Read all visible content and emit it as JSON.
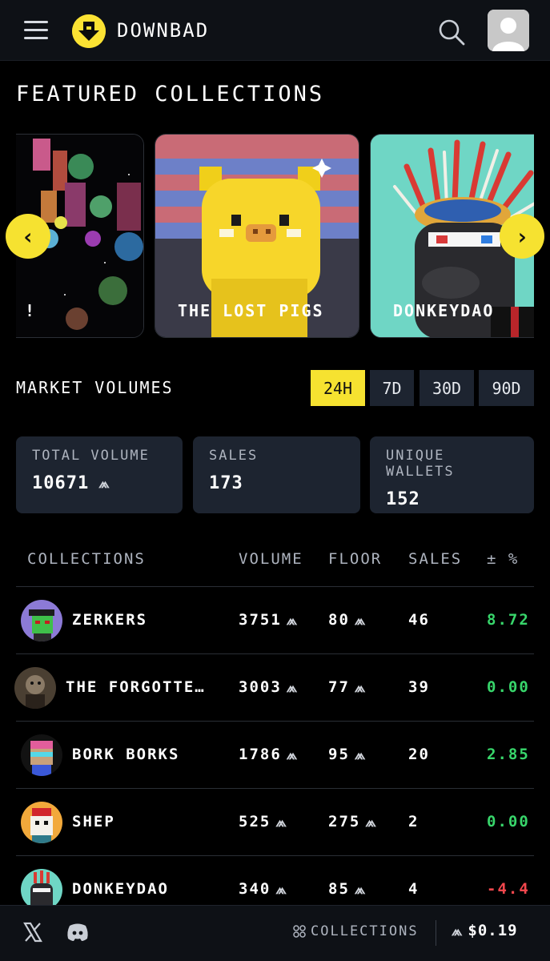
{
  "header": {
    "brand": "DOWNBAD",
    "menu_icon": "hamburger-icon",
    "search_icon": "search-icon",
    "avatar_icon": "user-avatar-icon"
  },
  "featured": {
    "title": "FEATURED COLLECTIONS",
    "cards": [
      {
        "label": "!"
      },
      {
        "label": "THE LOST PIGS"
      },
      {
        "label": "DONKEYDAO"
      }
    ],
    "prev_glyph": "‹",
    "next_glyph": "›"
  },
  "market": {
    "title": "MARKET VOLUMES",
    "tabs": [
      "24H",
      "7D",
      "30D",
      "90D"
    ],
    "active_tab": "24H",
    "stats": [
      {
        "label": "TOTAL VOLUME",
        "value": "10671"
      },
      {
        "label": "SALES",
        "value": "173"
      },
      {
        "label": "UNIQUE WALLETS",
        "value": "152"
      }
    ]
  },
  "table": {
    "headers": {
      "collections": "COLLECTIONS",
      "volume": "VOLUME",
      "floor": "FLOOR",
      "sales": "SALES",
      "change": "± %"
    },
    "rows": [
      {
        "name": "ZERKERS",
        "volume": "3751",
        "floor": "80",
        "sales": "46",
        "change": "8.72"
      },
      {
        "name": "THE FORGOTTE…",
        "volume": "3003",
        "floor": "77",
        "sales": "39",
        "change": "0.00"
      },
      {
        "name": "BORK BORKS",
        "volume": "1786",
        "floor": "95",
        "sales": "20",
        "change": "2.85"
      },
      {
        "name": "SHEP",
        "volume": "525",
        "floor": "275",
        "sales": "2",
        "change": "0.00"
      },
      {
        "name": "DONKEYDAO",
        "volume": "340",
        "floor": "85",
        "sales": "4",
        "change": "-4.4"
      }
    ]
  },
  "footer": {
    "collections_label": "COLLECTIONS",
    "price": "$0.19"
  },
  "colors": {
    "accent": "#f6e230",
    "positive": "#38d66b",
    "negative": "#f2474d",
    "panel": "#1d2430"
  }
}
